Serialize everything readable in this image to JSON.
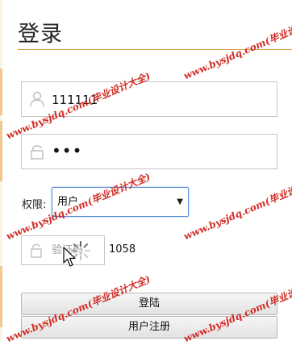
{
  "page": {
    "title": "登录"
  },
  "login_form": {
    "username_value": "111111",
    "password_value": "•••",
    "role_label": "权限:",
    "role_selected": "用户",
    "captcha_placeholder": "验证码",
    "captcha_code": "1058",
    "login_button": "登陆",
    "register_button": "用户注册"
  },
  "watermark": {
    "text": "www.bysjdq.com(毕业设计大全)"
  },
  "colors": {
    "accent_rule": "#d89b3f",
    "select_focus": "#5a8fd8",
    "watermark": "#cf1c14"
  },
  "icons": {
    "username": "user-icon",
    "password": "lock-icon",
    "captcha": "lock-icon",
    "dropdown": "caret-down-icon",
    "loading": "spinner-icon",
    "pointer": "mouse-cursor-icon"
  }
}
